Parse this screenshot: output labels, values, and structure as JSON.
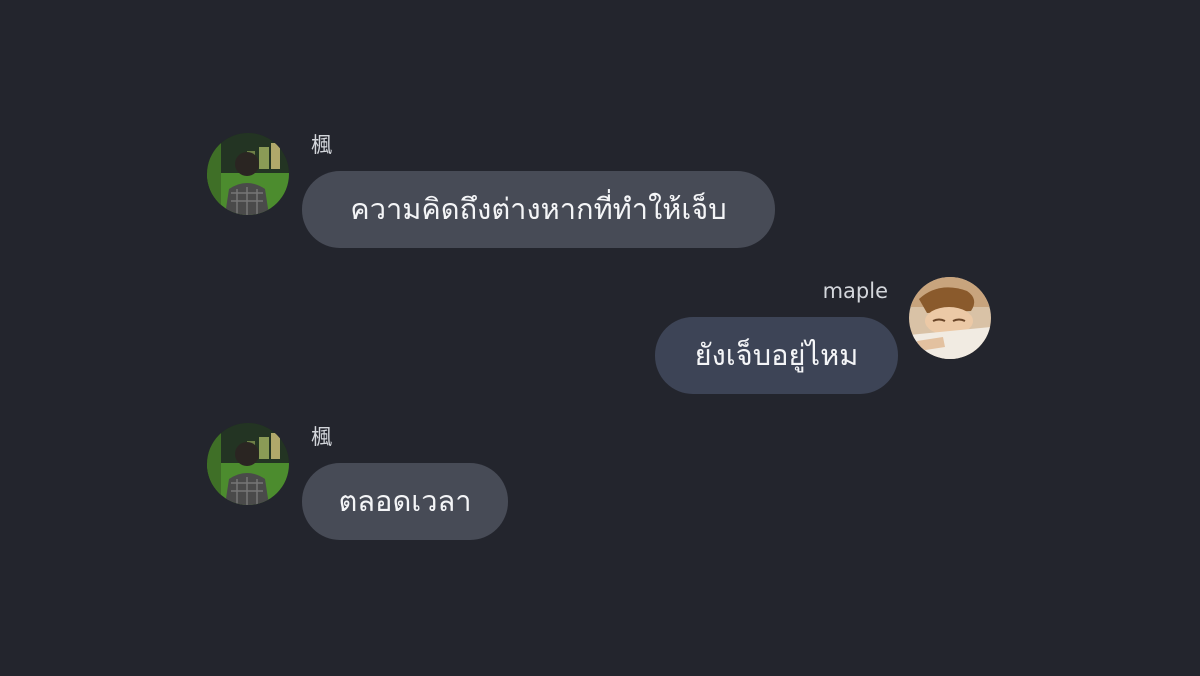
{
  "messages": [
    {
      "direction": "incoming",
      "sender": "楓",
      "avatar_icon": "user-photo-avatar",
      "text": "ความคิดถึงต่างหากที่ทำให้เจ็บ"
    },
    {
      "direction": "outgoing",
      "sender": "maple",
      "avatar_icon": "user-photo-avatar",
      "text": "ยังเจ็บอยู่ไหม"
    },
    {
      "direction": "incoming",
      "sender": "楓",
      "avatar_icon": "user-photo-avatar",
      "text": "ตลอดเวลา"
    }
  ],
  "colors": {
    "background": "#23252d",
    "incoming_bubble": "#474b56",
    "outgoing_bubble": "#3d4456",
    "sender_text": "#d4d7dc",
    "message_text": "#f4f5f7"
  }
}
